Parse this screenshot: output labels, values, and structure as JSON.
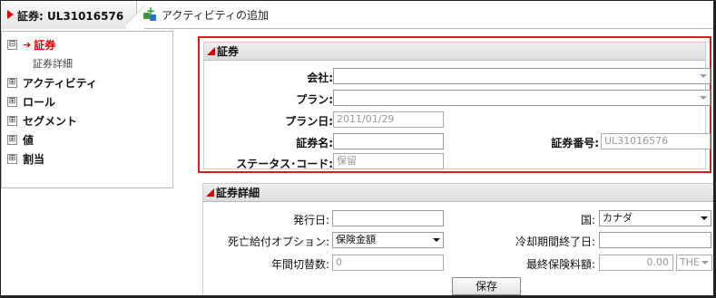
{
  "header": {
    "title": "証券: UL31016576",
    "action_label": "アクティビティの追加",
    "separator": "⁝"
  },
  "sidebar": {
    "items": [
      {
        "label": "証券",
        "toggle": "⊟",
        "active": true,
        "arrow": "➔"
      },
      {
        "label": "アクティビティ",
        "toggle": "⊞"
      },
      {
        "label": "ロール",
        "toggle": "⊞"
      },
      {
        "label": "セグメント",
        "toggle": "⊞"
      },
      {
        "label": "値",
        "toggle": "⊞"
      },
      {
        "label": "割当",
        "toggle": "⊞"
      }
    ],
    "sub_item": "証券詳細"
  },
  "policy_panel": {
    "title": "証券",
    "company_label": "会社:",
    "company_value": "",
    "plan_label": "プラン:",
    "plan_value": "",
    "plan_date_label": "プラン日:",
    "plan_date_value": "2011/01/29",
    "policy_name_label": "証券名:",
    "policy_name_value": "",
    "policy_number_label": "証券番号:",
    "policy_number_value": "UL31016576",
    "status_label": "ステータス･コード:",
    "status_value": "保留"
  },
  "detail_panel": {
    "title": "証券詳細",
    "issue_date_label": "発行日:",
    "issue_date_value": "",
    "country_label": "国:",
    "country_value": "カナダ",
    "death_benefit_label": "死亡給付オプション:",
    "death_benefit_value": "保険金額",
    "cooling_end_label": "冷却期間終了日:",
    "cooling_end_value": "",
    "annual_switch_label": "年間切替数:",
    "annual_switch_value": "0",
    "final_premium_label": "最終保険料額:",
    "final_premium_value": "0.00",
    "currency_value": "THE"
  },
  "buttons": {
    "save_label": "保存"
  },
  "colors": {
    "accent": "#d00000",
    "panel_border": "#d32020"
  }
}
